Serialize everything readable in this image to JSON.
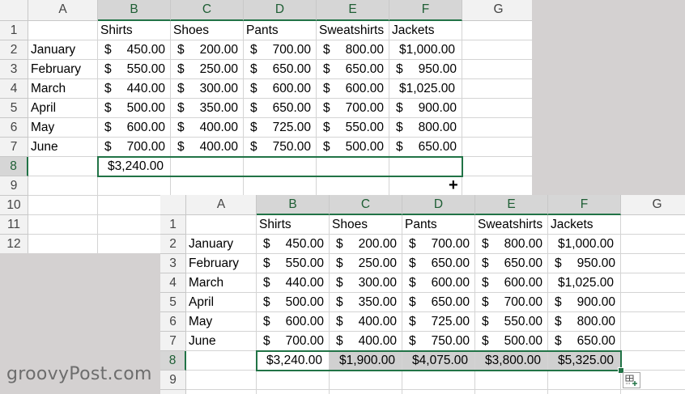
{
  "col_headers": [
    "A",
    "B",
    "C",
    "D",
    "E",
    "F",
    "G"
  ],
  "row_numbers": [
    "1",
    "2",
    "3",
    "4",
    "5",
    "6",
    "7",
    "8",
    "9",
    "10",
    "11",
    "12"
  ],
  "header_row": [
    "",
    "Shirts",
    "Shoes",
    "Pants",
    "Sweatshirts",
    "Jackets"
  ],
  "months": [
    "January",
    "February",
    "March",
    "April",
    "May",
    "June"
  ],
  "data": [
    [
      "450.00",
      "200.00",
      "700.00",
      "800.00",
      "$1,000.00"
    ],
    [
      "550.00",
      "250.00",
      "650.00",
      "650.00",
      "950.00"
    ],
    [
      "440.00",
      "300.00",
      "600.00",
      "600.00",
      "$1,025.00"
    ],
    [
      "500.00",
      "350.00",
      "650.00",
      "700.00",
      "900.00"
    ],
    [
      "600.00",
      "400.00",
      "725.00",
      "550.00",
      "800.00"
    ],
    [
      "700.00",
      "400.00",
      "750.00",
      "500.00",
      "650.00"
    ]
  ],
  "currency_symbol": "$",
  "totals_before": [
    "$3,240.00"
  ],
  "totals_after": [
    "$3,240.00",
    "$1,900.00",
    "$4,075.00",
    "$3,800.00",
    "$5,325.00"
  ],
  "fill_cursor_glyph": "+",
  "watermark": "groovyPost.com",
  "colors": {
    "selection_green": "#217346",
    "selected_fill": "#d0d0d0",
    "header_fill": "#f2f2f2"
  }
}
